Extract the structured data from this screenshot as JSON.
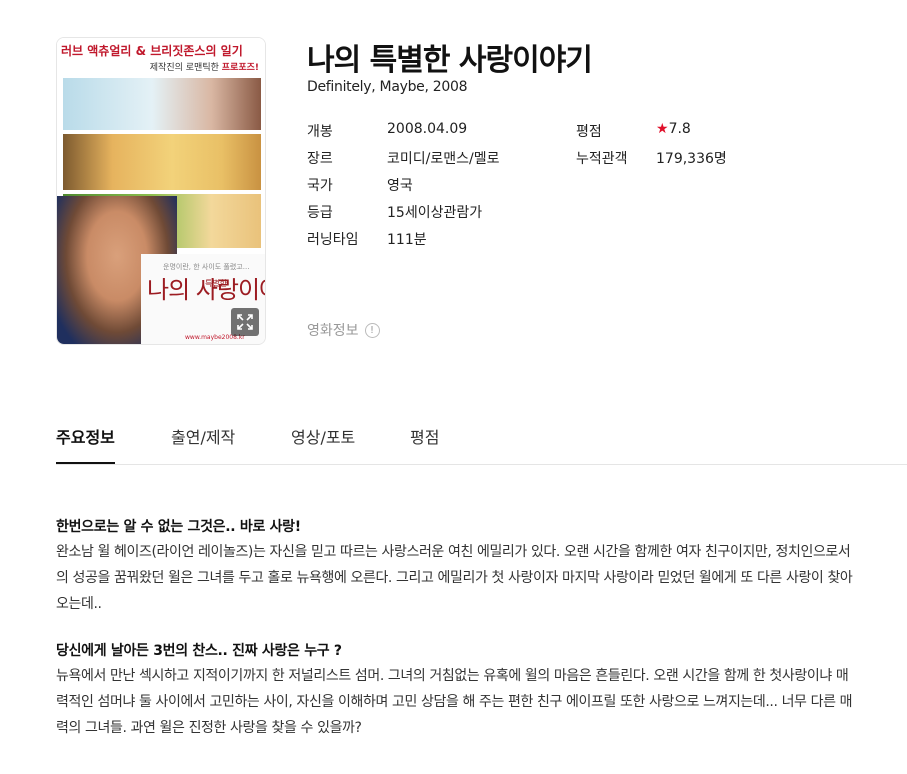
{
  "poster": {
    "tagline_top": "러브 액츄얼리 & 브리짓존스의 일기",
    "tagline_sub_prefix": "제작진의 로맨틱한",
    "tagline_sub_em": "프로포즈!",
    "logo_small": "운명이란, 한 사이도 풀렸고...",
    "logo_title": "나의 사랑이야기",
    "logo_sub": "특별한",
    "logo_url": "www.maybe2008.kr",
    "expand_icon": "expand-icon"
  },
  "movie": {
    "title": "나의 특별한 사랑이야기",
    "subtitle": "Definitely, Maybe, 2008"
  },
  "details_left": [
    {
      "label": "개봉",
      "value": "2008.04.09"
    },
    {
      "label": "장르",
      "value": "코미디/로맨스/멜로"
    },
    {
      "label": "국가",
      "value": "영국"
    },
    {
      "label": "등급",
      "value": "15세이상관람가"
    },
    {
      "label": "러닝타임",
      "value": "111분"
    }
  ],
  "details_right": [
    {
      "label": "평점",
      "star": "★",
      "value": "7.8"
    },
    {
      "label": "누적관객",
      "value": "179,336명"
    }
  ],
  "movie_info_link": {
    "label": "영화정보",
    "icon": "!"
  },
  "tabs": [
    {
      "label": "주요정보",
      "active": true
    },
    {
      "label": "출연/제작",
      "active": false
    },
    {
      "label": "영상/포토",
      "active": false
    },
    {
      "label": "평점",
      "active": false
    }
  ],
  "synopsis": [
    {
      "heading": "한번으로는 알 수 없는 그것은.. 바로 사랑!",
      "body": "완소남 윌 헤이즈(라이언 레이놀즈)는 자신을 믿고 따르는 사랑스러운 여친 에밀리가 있다. 오랜 시간을 함께한 여자 친구이지만, 정치인으로서의 성공을 꿈꿔왔던 윌은 그녀를 두고 홀로 뉴욕행에 오른다. 그리고 에밀리가 첫 사랑이자 마지막 사랑이라 믿었던 윌에게 또 다른 사랑이 찾아 오는데.."
    },
    {
      "heading": "당신에게 날아든 3번의 찬스.. 진짜 사랑은 누구 ?",
      "body": "뉴욕에서 만난 섹시하고 지적이기까지 한 저널리스트 섬머. 그녀의 거침없는 유혹에 윌의 마음은 흔들린다. 오랜 시간을 함께 한 첫사랑이냐 매력적인 섬머냐 둘 사이에서 고민하는 사이, 자신을 이해하며 고민 상담을 해 주는 편한 친구 에이프릴 또한 사랑으로 느껴지는데... 너무 다른 매력의 그녀들. 과연 윌은 진정한 사랑을 찾을 수 있을까?"
    }
  ],
  "colors": {
    "star": "#e0102b",
    "accent": "#c0182c"
  }
}
